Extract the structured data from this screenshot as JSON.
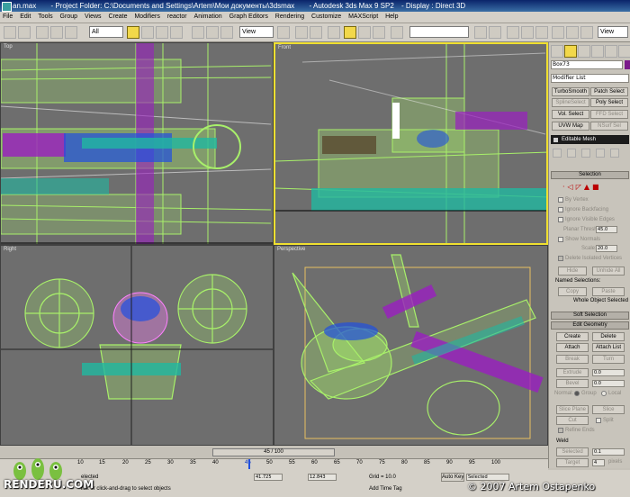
{
  "window": {
    "file": "an.max",
    "project": "- Project Folder: C:\\Documents and Settings\\Artem\\Мои документы\\3dsmax",
    "app": "- Autodesk 3ds Max 9 SP2",
    "display": "- Display : Direct 3D"
  },
  "menu": [
    "File",
    "Edit",
    "Tools",
    "Group",
    "Views",
    "Create",
    "Modifiers",
    "reactor",
    "Animation",
    "Graph Editors",
    "Rendering",
    "Customize",
    "MAXScript",
    "Help"
  ],
  "toolbar": {
    "selection_filter": "All",
    "reference_coord": "View",
    "named_selection": "",
    "view_combo": "View"
  },
  "viewports": {
    "top": "Top",
    "front": "Front",
    "left": "Right",
    "perspective": "Perspective"
  },
  "command_panel": {
    "object_name": "Box73",
    "modifier_list": "Modifier List",
    "modifier_buttons": [
      "TurboSmooth",
      "Patch Select",
      "SplineSelect",
      "Poly Select",
      "Vol. Select",
      "FFD Select",
      "UVW Map",
      "NSurf Sel"
    ],
    "stack_item": "Editable Mesh",
    "selection": {
      "title": "Selection",
      "by_vertex": "By Vertex",
      "ignore_backfacing": "Ignore Backfacing",
      "ignore_visible_edges": "Ignore Visible Edges",
      "planar_thresh": "Planar Thresh:",
      "planar_value": "45.0",
      "show_normals": "Show Normals",
      "scale": "Scale:",
      "scale_value": "20.0",
      "delete_isolated": "Delete Isolated Vertices",
      "hide": "Hide",
      "unhide_all": "Unhide All",
      "named_selections": "Named Selections:",
      "copy": "Copy",
      "paste": "Paste",
      "whole_object": "Whole Object Selected"
    },
    "soft_selection": "Soft Selection",
    "edit_geometry": {
      "title": "Edit Geometry",
      "create": "Create",
      "delete": "Delete",
      "attach": "Attach",
      "attach_list": "Attach List",
      "break": "Break",
      "turn": "Turn",
      "extrude": "Extrude",
      "extrude_value": "0.0",
      "bevel": "Bevel",
      "bevel_value": "0.0",
      "normal": "Normal:",
      "group": "Group",
      "local": "Local",
      "slice_plane": "Slice Plane",
      "slice": "Slice",
      "cut": "Cut",
      "split": "Split",
      "refine_ends": "Refine Ends",
      "weld": "Weld",
      "selected": "Selected",
      "selected_value": "0.1",
      "target": "Target",
      "target_value": "4",
      "pixels": "pixels"
    }
  },
  "time_slider": "45 / 100",
  "track_ticks": [
    "10",
    "15",
    "20",
    "25",
    "30",
    "35",
    "40",
    "45",
    "50",
    "55",
    "60",
    "65",
    "70",
    "75",
    "80",
    "85",
    "90",
    "95",
    "100"
  ],
  "status": {
    "selected": "elected",
    "x": "41.725",
    "z": "12.843",
    "grid": "Grid = 10.0",
    "auto_key": "Auto Key",
    "selected_combo": "Selected",
    "prompt": "lick or click-and-drag to select objects",
    "add_time_tag": "Add Time Tag"
  },
  "watermark": {
    "logo": "RENDERU.COM",
    "copyright": "© 2007 Artem Ostapenko"
  },
  "colors": {
    "viewport_bg": "#6e6e6e",
    "active_border": "#f0e030",
    "wire_green": "#a8f06a",
    "wire_purple": "#9a1ec0",
    "wire_teal": "#20b8a0",
    "wire_blue": "#2050e0"
  }
}
